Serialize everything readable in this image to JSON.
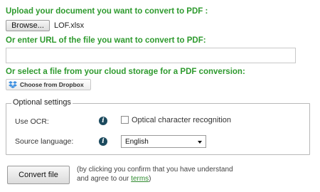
{
  "upload": {
    "heading": "Upload your document you want to convert to PDF :",
    "browse_label": "Browse...",
    "filename": "LOF.xlsx"
  },
  "url_section": {
    "heading": "Or enter URL of the file you want to convert to PDF:",
    "value": ""
  },
  "cloud": {
    "heading": "Or select a file from your cloud storage for a PDF conversion:",
    "dropbox_label": "Choose from Dropbox"
  },
  "optional": {
    "legend": "Optional settings",
    "ocr_label": "Use OCR:",
    "ocr_checkbox_label": "Optical character recognition",
    "ocr_checked": false,
    "source_language_label": "Source language:",
    "source_language_value": "English"
  },
  "convert": {
    "button_label": "Convert file",
    "note_line1": "(by clicking you confirm that you have understand",
    "note_line2_prefix": "and agree to our ",
    "terms_link": "terms",
    "note_line2_suffix": ")"
  },
  "colors": {
    "heading_green": "#2e9a2e",
    "dropbox_blue": "#3d8fe0",
    "info_icon": "#1c4a5e"
  }
}
